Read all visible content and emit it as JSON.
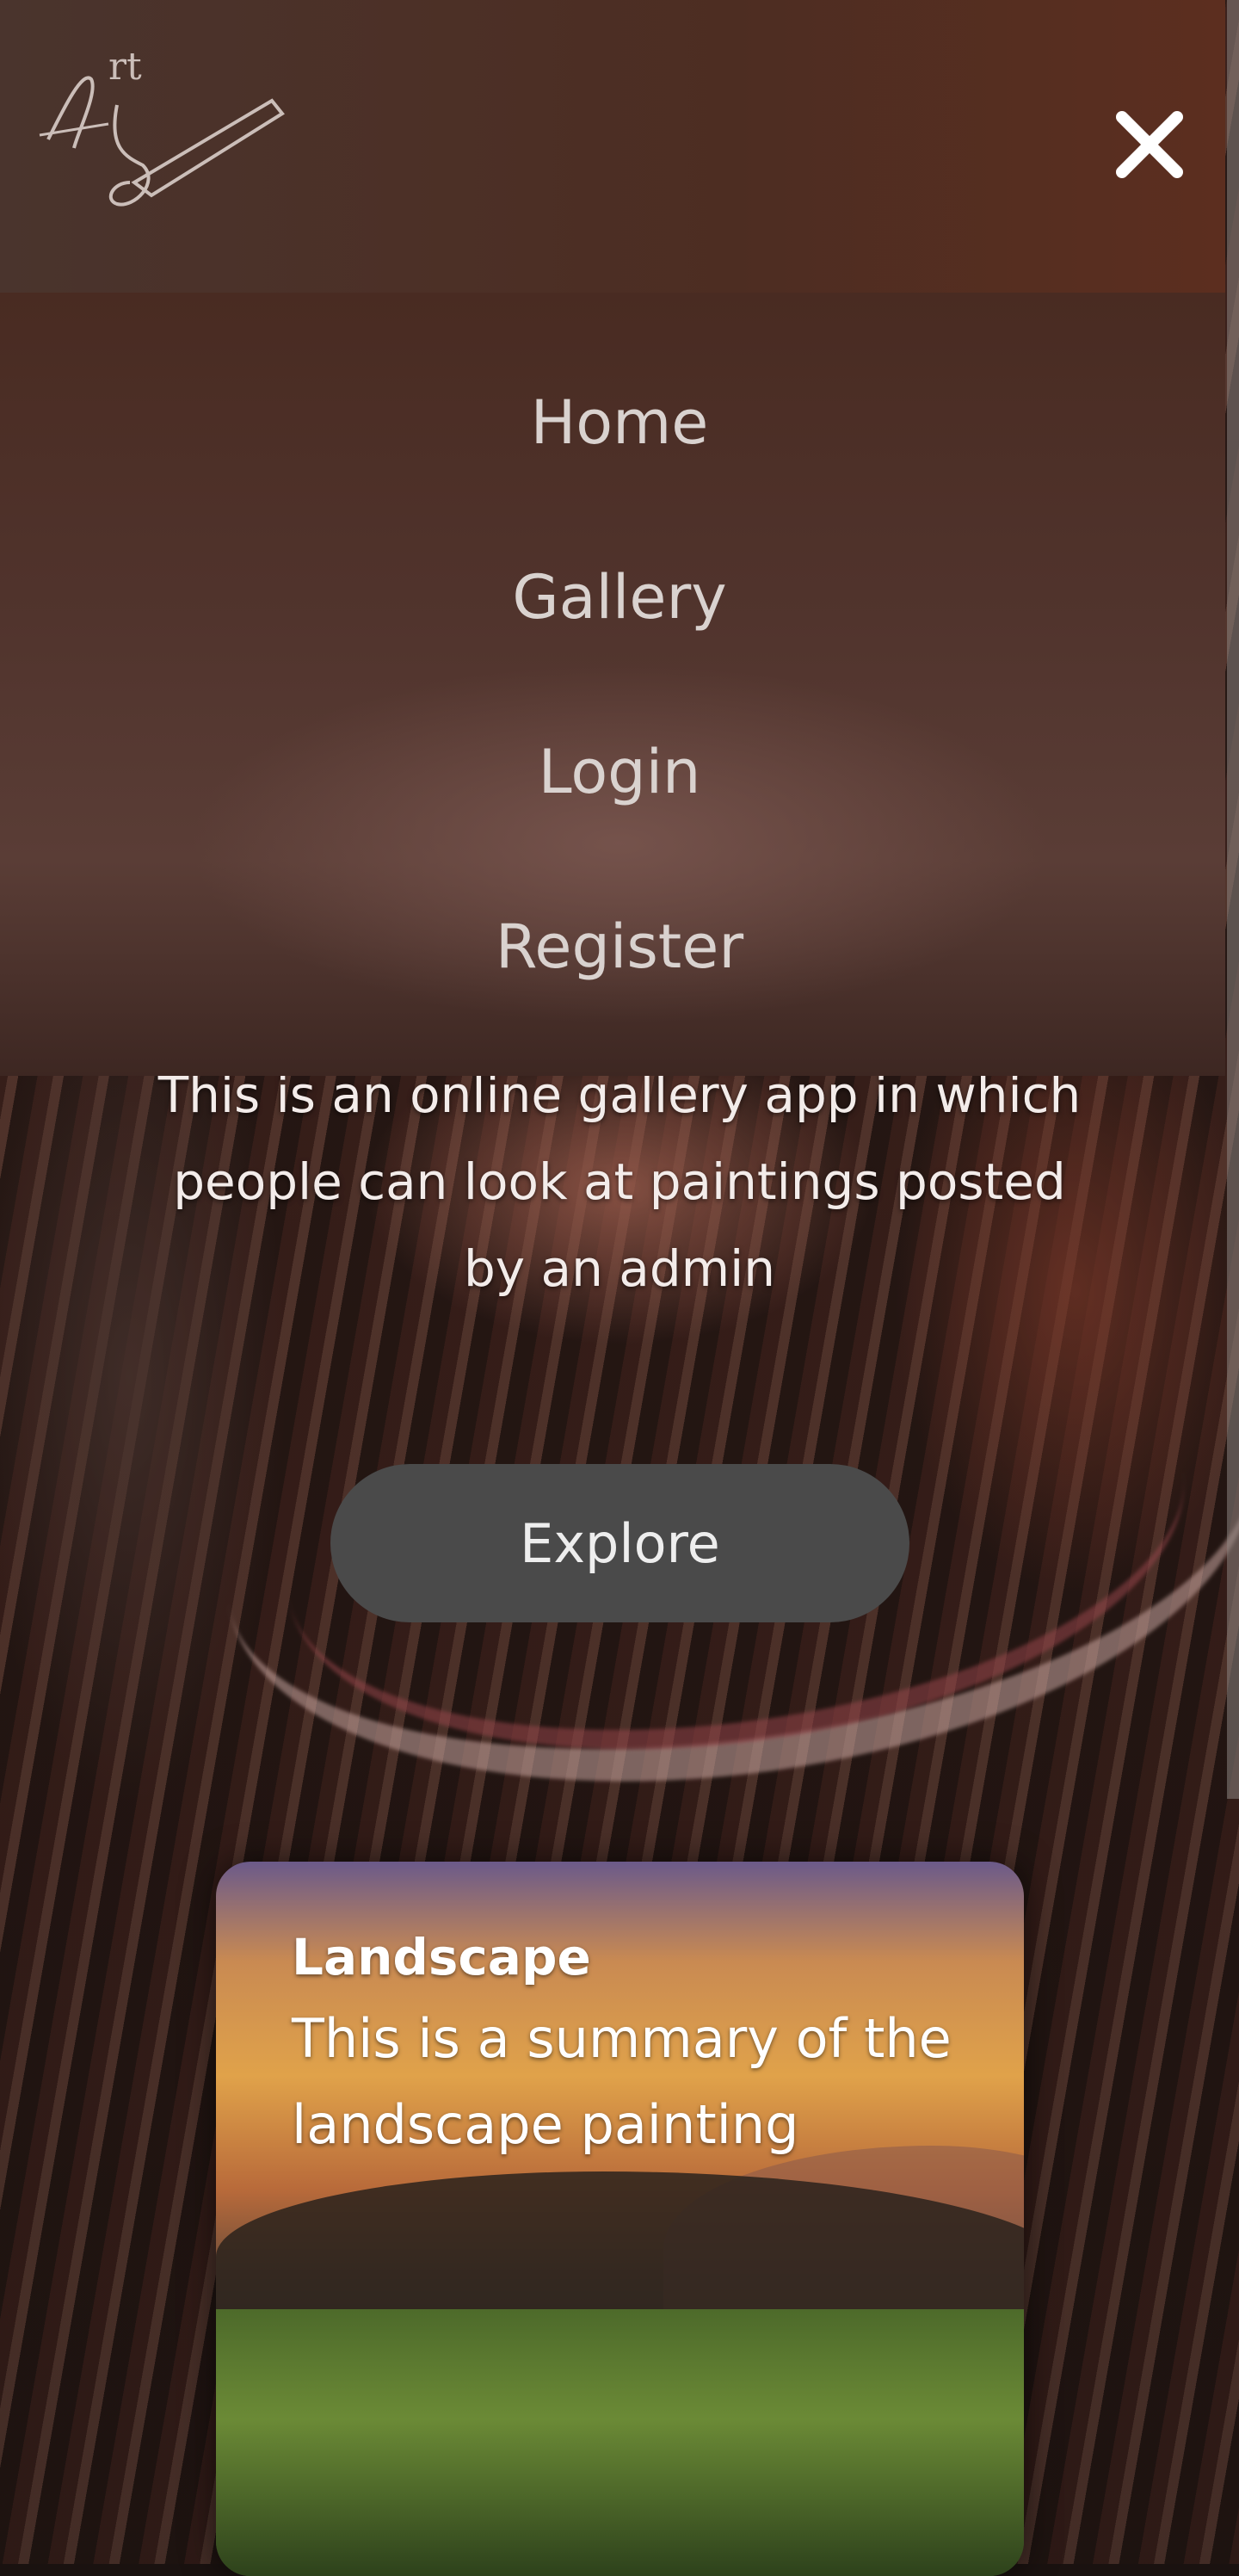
{
  "hero": {
    "description": "This is an online gallery app in which people can look at paintings posted by an admin",
    "explore_label": "Explore"
  },
  "card": {
    "title": "Landscape",
    "summary": "This is a summary of the landscape painting"
  },
  "nav": {
    "logo_text": "Art",
    "close_icon": "close-icon",
    "items": [
      {
        "label": "Home"
      },
      {
        "label": "Gallery"
      },
      {
        "label": "Login"
      },
      {
        "label": "Register"
      }
    ]
  },
  "colors": {
    "button_bg": "#4a4a4a",
    "nav_text": "#d9d2cf",
    "text_light": "#f3ecea"
  }
}
